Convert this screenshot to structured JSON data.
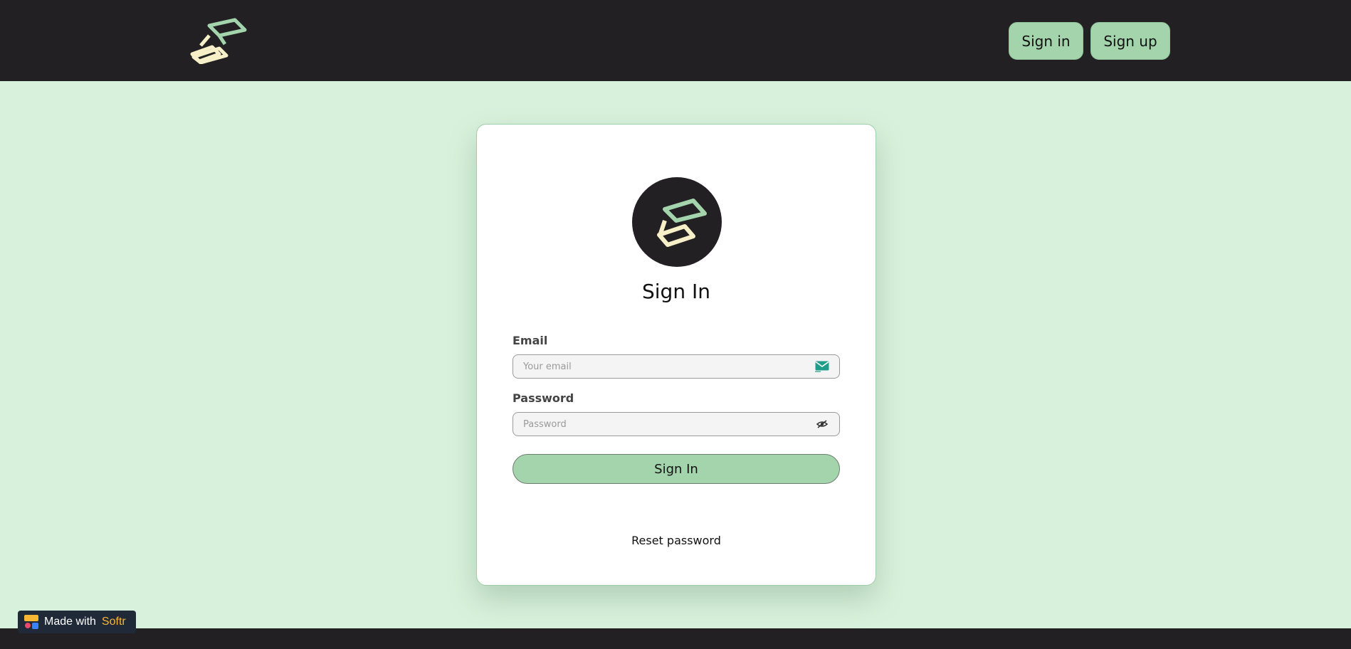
{
  "header": {
    "logo_icon": "brand-logo-icon",
    "signin_label": "Sign in",
    "signup_label": "Sign up"
  },
  "card": {
    "avatar_icon": "brand-logo-icon",
    "title": "Sign In",
    "email": {
      "label": "Email",
      "placeholder": "Your email",
      "value": "",
      "icon": "mail-icon"
    },
    "password": {
      "label": "Password",
      "placeholder": "Password",
      "value": "",
      "icon": "eye-off-icon"
    },
    "submit_label": "Sign In",
    "reset_label": "Reset password"
  },
  "badge": {
    "prefix": "Made with",
    "brand": "Softr"
  },
  "colors": {
    "page_bg": "#d8f1dc",
    "header_bg": "#222022",
    "accent_green": "#a4d4ac",
    "logo_cream": "#f6efc8",
    "softr_yellow": "#f7b733"
  }
}
